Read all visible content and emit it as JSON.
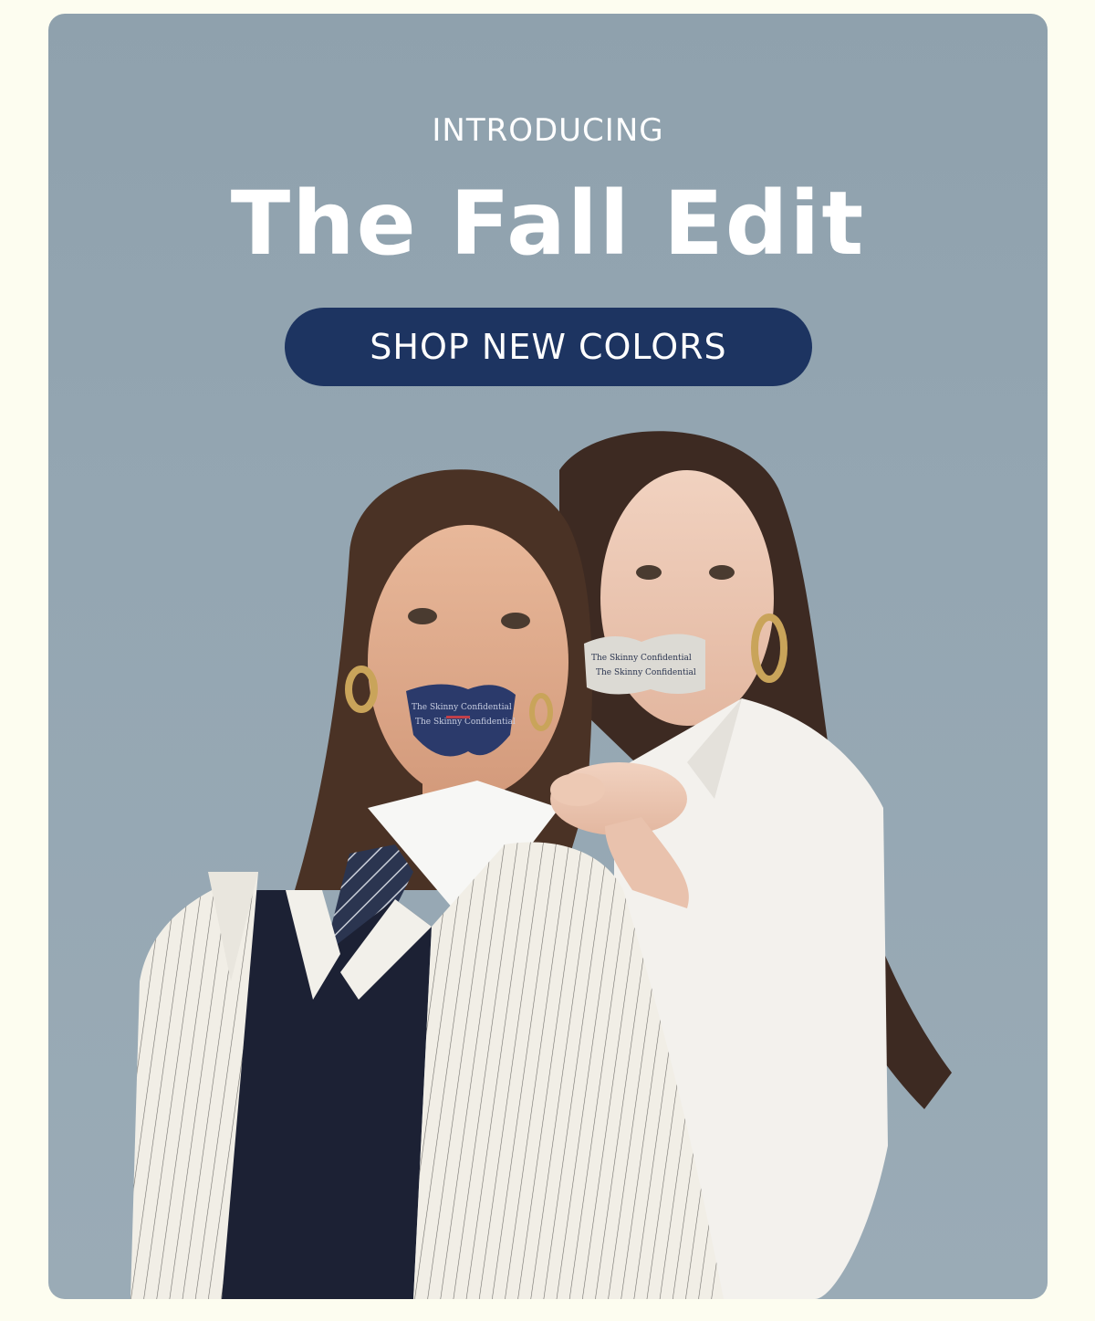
{
  "hero": {
    "eyebrow": "INTRODUCING",
    "headline": "The Fall Edit",
    "cta_label": "SHOP NEW COLORS"
  },
  "product": {
    "strip_text": "The Skinny Confidential"
  },
  "colors": {
    "page_background": "#fdfdf0",
    "card_background": "#94a6b2",
    "cta_background": "#1d3461",
    "text": "#ffffff"
  }
}
